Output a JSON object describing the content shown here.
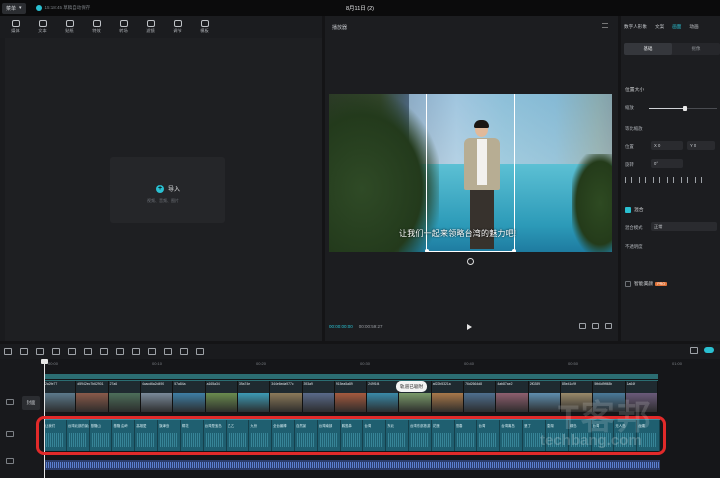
{
  "titlebar": {
    "menu_label": "菜单",
    "autosave_text": "15:18:45 草稿自动保存",
    "doc_title": "8月11日 (2)"
  },
  "toolbar": {
    "items": [
      {
        "label": "媒体",
        "icon": "media-icon"
      },
      {
        "label": "文本",
        "icon": "text-icon"
      },
      {
        "label": "贴纸",
        "icon": "sticker-icon"
      },
      {
        "label": "特效",
        "icon": "effects-icon"
      },
      {
        "label": "转场",
        "icon": "transition-icon"
      },
      {
        "label": "滤镜",
        "icon": "filter-icon"
      },
      {
        "label": "调节",
        "icon": "adjust-icon"
      },
      {
        "label": "模板",
        "icon": "template-icon"
      }
    ]
  },
  "media": {
    "import_label": "导入",
    "import_hint": "视频、音频、图片"
  },
  "player": {
    "title": "播放器",
    "subtitle": "让我们一起来领略台湾的魅力吧!",
    "current_time": "00:00:00:00",
    "total_time": "00:00:59:27"
  },
  "properties": {
    "tabs": [
      "数字人形象",
      "文案",
      "画面",
      "动画"
    ],
    "active_tab": "画面",
    "subtabs": [
      "基础",
      "抠像"
    ],
    "active_subtab": "基础",
    "position_size_label": "位置大小",
    "scale_label": "缩放",
    "scale_value": 0.53,
    "proportional_label": "等比缩放",
    "position_label": "位置",
    "pos_x": "X  0",
    "pos_y": "Y  0",
    "rotate_label": "旋转",
    "rotate_value": "0°",
    "blend_label": "混合",
    "blend_mode_label": "混合模式",
    "blend_mode_value": "正常",
    "opacity_label": "不透明度",
    "smart_beauty_label": "智能美颜",
    "pro_badge": "PRO"
  },
  "timeline": {
    "ruler_ticks": [
      "00:00",
      "00:10",
      "00:20",
      "00:30",
      "00:40",
      "00:50",
      "01:00"
    ],
    "cover_label": "封面",
    "tooltip": "轨道已吸附",
    "clips": [
      {
        "name": "2a2fe77",
        "color": "#5c7a8c"
      },
      {
        "name": "d5942ec7b62901",
        "color": "#8a5a4a"
      },
      {
        "name": "27a6",
        "color": "#4d6e5a"
      },
      {
        "name": "4cacd6a2d490",
        "color": "#7a8a9a"
      },
      {
        "name": "57a84a",
        "color": "#3f7fa5"
      },
      {
        "name": "a165a34",
        "color": "#6a8c4f"
      },
      {
        "name": "39a74e",
        "color": "#3d9bb5"
      },
      {
        "name": "344e6eda977c",
        "color": "#8c7a5a"
      },
      {
        "name": "393a9",
        "color": "#5a6a8a"
      },
      {
        "name": "915ea5a89",
        "color": "#a55a3f"
      },
      {
        "name": "249f1f4",
        "color": "#3a8aa8"
      },
      {
        "name": "2d1b5ab01",
        "color": "#7a9a6a"
      },
      {
        "name": "af22b5321a",
        "color": "#a8784a"
      },
      {
        "name": "76d2664d8",
        "color": "#4f6f8f"
      },
      {
        "name": "4ab87ae2",
        "color": "#8f5f6f"
      },
      {
        "name": "2f0289",
        "color": "#5f8faf"
      },
      {
        "name": "85e41c9f",
        "color": "#9a8a6a"
      },
      {
        "name": "5fb6d9ff48b",
        "color": "#4a7a9a"
      },
      {
        "name": "1a64f",
        "color": "#6a5a7a"
      }
    ],
    "tts_clips": [
      "让我们",
      "台湾北部的景点",
      "基隆山",
      "基隆 由岭",
      "高雄愛",
      "旗津島",
      "桐花",
      "台湾是宝岛",
      "乙乙",
      "九份",
      "全台最棒",
      "自然景",
      "台湾南部",
      "鹅鸾鼻",
      "台湾",
      "东北",
      "台湾东部旅游",
      "花莲",
      "恒春",
      "台湾",
      "台湾离岛",
      "垦丁",
      "澎湖",
      "绿岛",
      "台湾",
      "无人岛",
      "台湾"
    ]
  },
  "watermark": {
    "logo_text": "T客邦",
    "site_text": "techbang.com"
  }
}
